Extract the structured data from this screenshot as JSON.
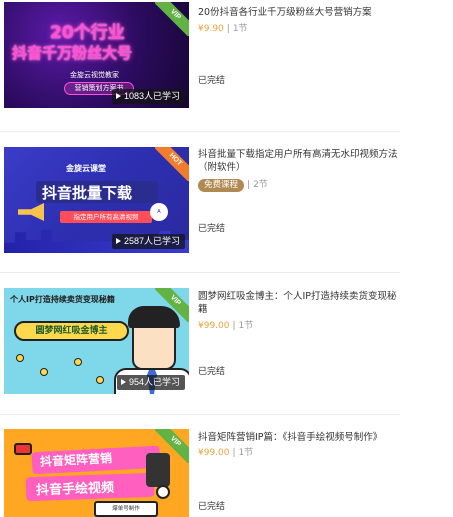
{
  "courses": [
    {
      "title": "20份抖音各行业千万级粉丝大号营销方案",
      "price": "¥9.90",
      "separator": "|",
      "lessons": "1节",
      "status": "已完结",
      "learners": "1083人已学习",
      "ribbon": "VIP",
      "thumb_text": {
        "line1": "20个行业",
        "line2": "抖音千万粉丝大号",
        "sub": "金旋云视觉教家",
        "button": "营销策划方案书"
      }
    },
    {
      "title": "抖音批量下载指定用户所有高清无水印视频方法（附软件）",
      "price_tag": "免费课程",
      "separator": "|",
      "lessons": "2节",
      "status": "已完结",
      "learners": "2587人已学习",
      "ribbon": "HOT",
      "thumb_text": {
        "brand": "金旋云课堂",
        "headline": "抖音批量下载",
        "pill": "指定用户所有高清视频",
        "badge": "A"
      }
    },
    {
      "title": "圆梦网红吸金博主：个人IP打造持续卖货变现秘籍",
      "price": "¥99.00",
      "separator": "|",
      "lessons": "1节",
      "status": "已完结",
      "learners": "954人已学习",
      "ribbon": "VIP",
      "thumb_text": {
        "head": "个人IP打造持续卖货变现秘籍",
        "bubble": "圆梦网红吸金博主"
      }
    },
    {
      "title": "抖音矩阵营销IP篇：《抖音手绘视频号制作》",
      "price": "¥99.00",
      "separator": "|",
      "lessons": "1节",
      "status": "已完结",
      "ribbon": "VIP",
      "thumb_text": {
        "line1": "抖音矩阵营销",
        "line2": "抖音手绘视频",
        "card": "爆单号制作"
      }
    }
  ],
  "colors": {
    "price": "#e8a33b",
    "free_tag_bg": "#b08a52",
    "ribbon_vip": "#62b343",
    "ribbon_hot": "#f07c2e"
  }
}
